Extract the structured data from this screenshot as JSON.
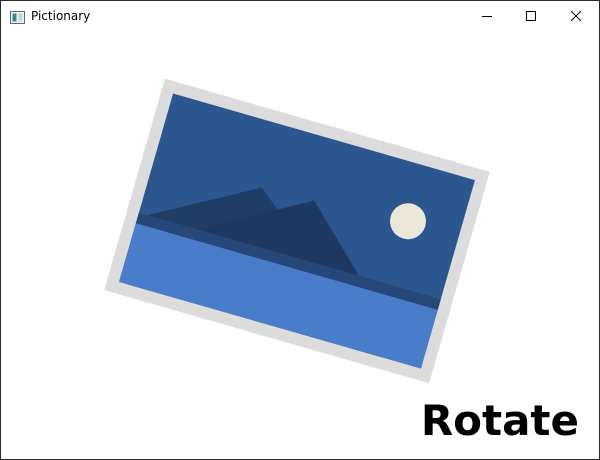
{
  "window": {
    "title": "Pictionary",
    "controls": {
      "minimize_icon": "minimize-icon",
      "maximize_icon": "maximize-icon",
      "close_icon": "close-icon"
    }
  },
  "canvas": {
    "image_icon": "landscape-photo-icon",
    "rotation_degrees": 16,
    "caption": "Rotate"
  },
  "colors": {
    "frame": "#dcdcdc",
    "sky": "#2b568f",
    "mountain_back": "#1f3d67",
    "mountain_front": "#1d3862",
    "shore": "#264878",
    "water": "#4a7dc9",
    "moon": "#ece7d9"
  }
}
